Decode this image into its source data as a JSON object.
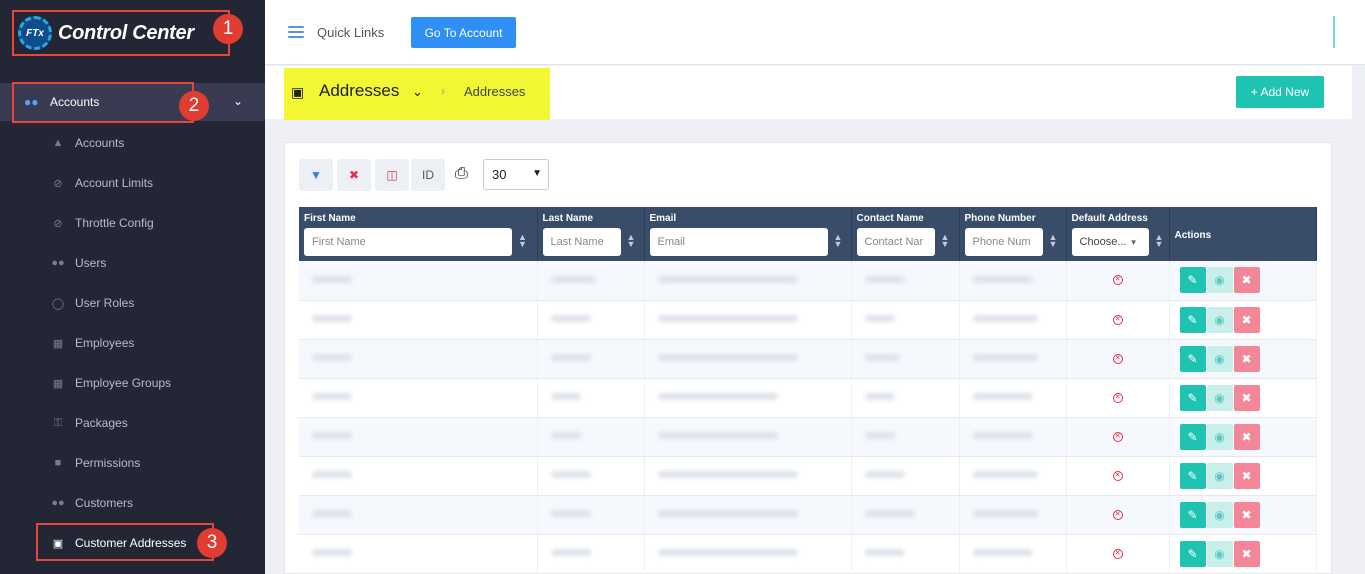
{
  "app": {
    "title": "Control Center",
    "logo_mark": "FTx"
  },
  "annotations": [
    "1",
    "2",
    "3"
  ],
  "sidebar": {
    "parent": {
      "label": "Accounts",
      "icon": "users-icon"
    },
    "items": [
      {
        "label": "Accounts",
        "icon": "bank-icon"
      },
      {
        "label": "Account Limits",
        "icon": "ban-icon"
      },
      {
        "label": "Throttle Config",
        "icon": "ban-icon"
      },
      {
        "label": "Users",
        "icon": "users-icon"
      },
      {
        "label": "User Roles",
        "icon": "user-cog-icon"
      },
      {
        "label": "Employees",
        "icon": "hierarchy-icon"
      },
      {
        "label": "Employee Groups",
        "icon": "hierarchy-icon"
      },
      {
        "label": "Packages",
        "icon": "key-icon"
      },
      {
        "label": "Permissions",
        "icon": "lock-icon"
      },
      {
        "label": "Customers",
        "icon": "users-icon"
      },
      {
        "label": "Customer Addresses",
        "icon": "address-book-icon",
        "active": true
      }
    ]
  },
  "topbar": {
    "quick_links": "Quick Links",
    "go_to_account": "Go To Account"
  },
  "page_header": {
    "title": "Addresses",
    "breadcrumb": "Addresses",
    "add_new": "Add New"
  },
  "toolbar": {
    "id_label": "ID",
    "page_size": "30"
  },
  "table": {
    "columns": [
      {
        "label": "First Name",
        "placeholder": "First Name"
      },
      {
        "label": "Last Name",
        "placeholder": "Last Name"
      },
      {
        "label": "Email",
        "placeholder": "Email"
      },
      {
        "label": "Contact Name",
        "placeholder": "Contact Nar"
      },
      {
        "label": "Phone Number",
        "placeholder": "Phone Num"
      },
      {
        "label": "Default Address",
        "placeholder": "Choose..."
      }
    ],
    "actions_label": "Actions",
    "row_count": 8
  },
  "colors": {
    "sidebar_bg": "#232634",
    "header_bg": "#394d6a",
    "accent_teal": "#1fc3b2",
    "primary_blue": "#2f8ff5",
    "highlight": "#f1f733",
    "annotation_red": "#e03c31"
  }
}
